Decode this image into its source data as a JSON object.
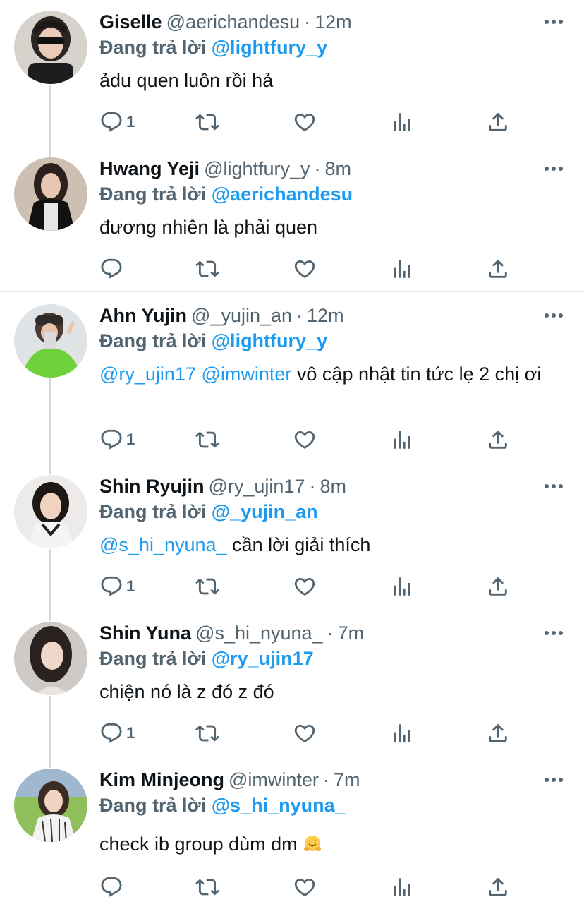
{
  "reply_prefix": "Đang trả lời",
  "tweets": [
    {
      "name": "Giselle",
      "handle": "@aerichandesu",
      "time": "12m",
      "reply_to": "@lightfury_y",
      "body_mentions": "",
      "body_text": "ảdu quen luôn rồi hả",
      "reply_count": "1"
    },
    {
      "name": "Hwang Yeji",
      "handle": "@lightfury_y",
      "time": "8m",
      "reply_to": "@aerichandesu",
      "body_mentions": "",
      "body_text": "đương nhiên là phải quen",
      "reply_count": ""
    },
    {
      "name": "Ahn Yujin",
      "handle": "@_yujin_an",
      "time": "12m",
      "reply_to": "@lightfury_y",
      "body_mentions": "@ry_ujin17 @imwinter",
      "body_text": " vô cập nhật tin tức lẹ 2 chị ơi",
      "reply_count": "1"
    },
    {
      "name": "Shin Ryujin",
      "handle": "@ry_ujin17",
      "time": "8m",
      "reply_to": "@_yujin_an",
      "body_mentions": "@s_hi_nyuna_",
      "body_text": " cần lời giải thích",
      "reply_count": "1"
    },
    {
      "name": "Shin Yuna",
      "handle": "@s_hi_nyuna_",
      "time": "7m",
      "reply_to": "@ry_ujin17",
      "body_mentions": "",
      "body_text": "chiện nó là z đó z đó",
      "reply_count": "1"
    },
    {
      "name": "Kim Minjeong",
      "handle": "@imwinter",
      "time": "7m",
      "reply_to": "@s_hi_nyuna_",
      "body_mentions": "",
      "body_text": "check ib group dùm dm ",
      "reply_count": ""
    }
  ],
  "colors": {
    "accent": "#1d9bf0",
    "secondary_text": "#536471",
    "primary_text": "#0f1419",
    "thread_line": "#cfd9de",
    "divider": "#e7e9ea"
  },
  "icons": [
    "reply-icon",
    "retweet-icon",
    "like-icon",
    "views-icon",
    "share-icon",
    "more-icon",
    "hugging-face-emoji"
  ]
}
